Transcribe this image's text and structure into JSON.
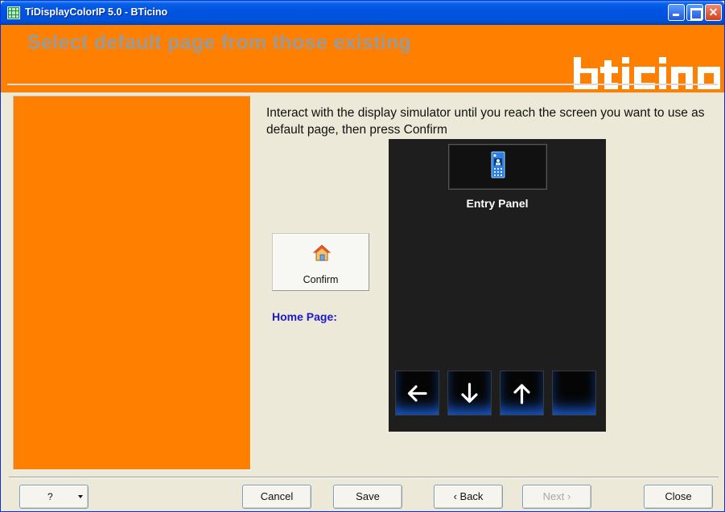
{
  "window": {
    "title": "TiDisplayColorIP 5.0 - BTicino",
    "controls": [
      "minimize",
      "maximize",
      "close"
    ]
  },
  "header": {
    "title": "Select default page from those existing",
    "logo": "bticino",
    "bg_color": "#ff8000"
  },
  "main": {
    "instructions": "Interact with the display simulator until you reach the screen you want to use as default page, then press Confirm",
    "confirm_label": "Confirm",
    "home_page_label": "Home Page:"
  },
  "simulator": {
    "entry_label": "Entry Panel",
    "entry_icon": "entry-panel-icon",
    "nav_buttons": [
      "arrow-left-icon",
      "arrow-down-icon",
      "arrow-up-icon",
      "blank"
    ]
  },
  "footer": {
    "help_label": "?",
    "cancel_label": "Cancel",
    "save_label": "Save",
    "back_label": "‹ Back",
    "next_label": "Next ›",
    "close_label": "Close"
  }
}
